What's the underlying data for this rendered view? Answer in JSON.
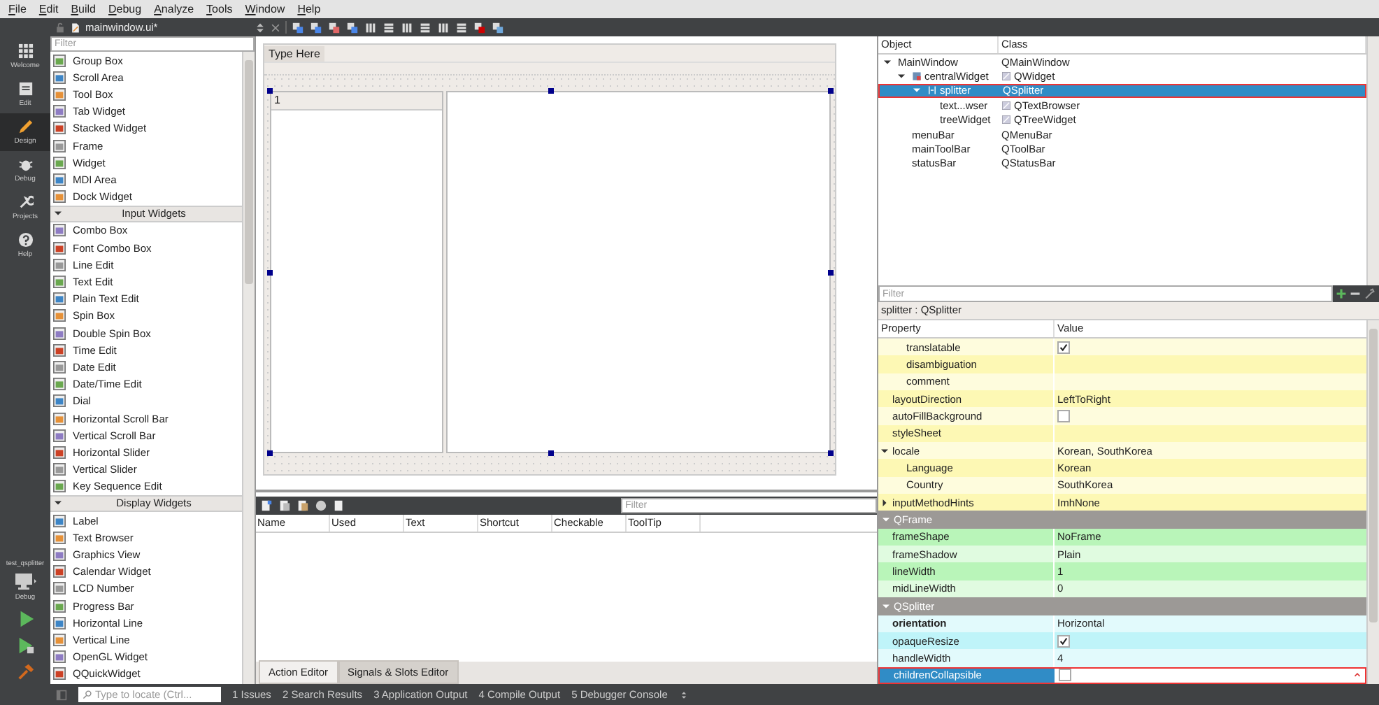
{
  "menu": [
    "File",
    "Edit",
    "Build",
    "Debug",
    "Analyze",
    "Tools",
    "Window",
    "Help"
  ],
  "mode_bar": {
    "items": [
      {
        "label": "Welcome",
        "selected": false
      },
      {
        "label": "Edit",
        "selected": false
      },
      {
        "label": "Design",
        "selected": true
      },
      {
        "label": "Debug",
        "selected": false
      },
      {
        "label": "Projects",
        "selected": false
      },
      {
        "label": "Help",
        "selected": false
      }
    ],
    "kit": {
      "project": "test_qsplitter",
      "mode": "Debug"
    }
  },
  "document": {
    "title": "mainwindow.ui*"
  },
  "widget_box": {
    "filter": {
      "placeholder": "Filter"
    },
    "sections": [
      {
        "items": [
          "Group Box",
          "Scroll Area",
          "Tool Box",
          "Tab Widget",
          "Stacked Widget",
          "Frame",
          "Widget",
          "MDI Area",
          "Dock Widget"
        ]
      },
      {
        "title": "Input Widgets",
        "expanded": true,
        "items": [
          "Combo Box",
          "Font Combo Box",
          "Line Edit",
          "Text Edit",
          "Plain Text Edit",
          "Spin Box",
          "Double Spin Box",
          "Time Edit",
          "Date Edit",
          "Date/Time Edit",
          "Dial",
          "Horizontal Scroll Bar",
          "Vertical Scroll Bar",
          "Horizontal Slider",
          "Vertical Slider",
          "Key Sequence Edit"
        ]
      },
      {
        "title": "Display Widgets",
        "expanded": true,
        "items": [
          "Label",
          "Text Browser",
          "Graphics View",
          "Calendar Widget",
          "LCD Number",
          "Progress Bar",
          "Horizontal Line",
          "Vertical Line",
          "OpenGL Widget",
          "QQuickWidget"
        ]
      }
    ]
  },
  "form": {
    "menu_placeholder": "Type Here",
    "tree_header": "1"
  },
  "action_editor": {
    "filter": {
      "placeholder": "Filter"
    },
    "columns": [
      "Name",
      "Used",
      "Text",
      "Shortcut",
      "Checkable",
      "ToolTip"
    ],
    "tabs": [
      {
        "label": "Action Editor",
        "selected": true
      },
      {
        "label": "Signals & Slots Editor",
        "selected": false
      }
    ]
  },
  "object_inspector": {
    "columns": [
      "Object",
      "Class"
    ],
    "tree": [
      {
        "name": "MainWindow",
        "class": "QMainWindow",
        "kind": "plain",
        "expanded": true,
        "selected": false,
        "children": [
          {
            "name": "centralWidget",
            "class": "QWidget",
            "kind": "container",
            "expanded": true,
            "selected": false,
            "children": [
              {
                "name": "splitter",
                "class": "QSplitter",
                "kind": "splitter",
                "expanded": true,
                "selected": true,
                "children": [
                  {
                    "name": "text...wser",
                    "class": "QTextBrowser",
                    "kind": "widget",
                    "selected": false
                  },
                  {
                    "name": "treeWidget",
                    "class": "QTreeWidget",
                    "kind": "widget",
                    "selected": false
                  }
                ]
              }
            ]
          },
          {
            "name": "menuBar",
            "class": "QMenuBar",
            "kind": "plain",
            "selected": false
          },
          {
            "name": "mainToolBar",
            "class": "QToolBar",
            "kind": "plain",
            "selected": false
          },
          {
            "name": "statusBar",
            "class": "QStatusBar",
            "kind": "plain",
            "selected": false
          }
        ]
      }
    ]
  },
  "property_editor": {
    "filter": {
      "placeholder": "Filter"
    },
    "title": "splitter : QSplitter",
    "columns": [
      "Property",
      "Value"
    ],
    "groups": [
      {
        "color": "#fdf8b4",
        "continued_children": [
          {
            "name": "translatable",
            "kind": "check",
            "checked": true,
            "modified": false,
            "selected": false
          },
          {
            "name": "disambiguation",
            "kind": "text",
            "modified": false,
            "selected": false
          },
          {
            "name": "comment",
            "kind": "text",
            "modified": false,
            "selected": false
          }
        ],
        "rows": [
          {
            "name": "layoutDirection",
            "kind": "text",
            "value": "LeftToRight",
            "modified": false,
            "selected": false
          },
          {
            "name": "autoFillBackground",
            "kind": "check",
            "checked": false,
            "modified": false,
            "selected": false
          },
          {
            "name": "styleSheet",
            "kind": "text",
            "modified": false,
            "selected": false
          },
          {
            "name": "locale",
            "kind": "text",
            "value": "Korean, SouthKorea",
            "modified": false,
            "selected": false,
            "expanded": true,
            "children": [
              {
                "name": "Language",
                "kind": "text",
                "value": "Korean",
                "modified": false,
                "selected": false
              },
              {
                "name": "Country",
                "kind": "text",
                "value": "SouthKorea",
                "modified": false,
                "selected": false
              }
            ]
          },
          {
            "name": "inputMethodHints",
            "kind": "text",
            "value": "ImhNone",
            "modified": false,
            "selected": false,
            "expanded": false
          }
        ]
      },
      {
        "title": "QFrame",
        "expanded": true,
        "color": "#b9f5b9",
        "rows": [
          {
            "name": "frameShape",
            "kind": "text",
            "value": "NoFrame",
            "modified": false,
            "selected": false
          },
          {
            "name": "frameShadow",
            "kind": "text",
            "value": "Plain",
            "modified": false,
            "selected": false
          },
          {
            "name": "lineWidth",
            "kind": "text",
            "value": "1",
            "modified": false,
            "selected": false
          },
          {
            "name": "midLineWidth",
            "kind": "text",
            "value": "0",
            "modified": false,
            "selected": false
          }
        ]
      },
      {
        "title": "QSplitter",
        "expanded": true,
        "color": "#bff4f9",
        "rows": [
          {
            "name": "orientation",
            "kind": "text",
            "value": "Horizontal",
            "modified": true,
            "selected": false
          },
          {
            "name": "opaqueResize",
            "kind": "check",
            "checked": true,
            "modified": false,
            "selected": false
          },
          {
            "name": "handleWidth",
            "kind": "text",
            "value": "4",
            "modified": false,
            "selected": false
          },
          {
            "name": "childrenCollapsible",
            "kind": "check",
            "checked": false,
            "modified": false,
            "selected": true
          }
        ]
      }
    ]
  },
  "status_bar": {
    "locate": {
      "placeholder": "Type to locate (Ctrl..."
    },
    "panes": [
      "1 Issues",
      "2 Search Results",
      "3 Application Output",
      "4 Compile Output",
      "5 Debugger Console"
    ]
  }
}
